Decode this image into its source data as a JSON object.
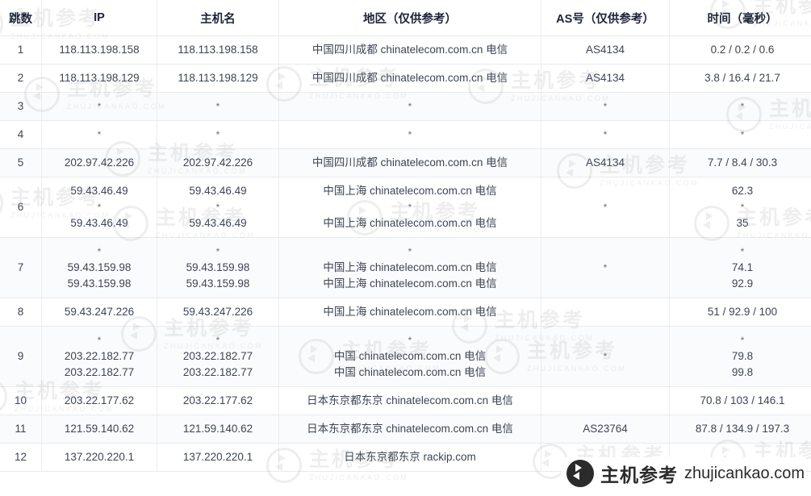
{
  "table": {
    "columns": [
      {
        "key": "hop",
        "label": "跳数"
      },
      {
        "key": "ip",
        "label": "IP"
      },
      {
        "key": "host",
        "label": "主机名"
      },
      {
        "key": "geo",
        "label": "地区（仅供参考）"
      },
      {
        "key": "as",
        "label": "AS号（仅供参考）"
      },
      {
        "key": "time",
        "label": "时间（毫秒）"
      }
    ],
    "rows": [
      {
        "hop": "1",
        "ip": [
          "118.113.198.158"
        ],
        "host": [
          "118.113.198.158"
        ],
        "geo": [
          "中国四川成都 chinatelecom.com.cn 电信"
        ],
        "as": [
          "AS4134"
        ],
        "time": [
          "0.2 / 0.2 / 0.6"
        ],
        "striped": false
      },
      {
        "hop": "2",
        "ip": [
          "118.113.198.129"
        ],
        "host": [
          "118.113.198.129"
        ],
        "geo": [
          "中国四川成都 chinatelecom.com.cn 电信"
        ],
        "as": [
          "AS4134"
        ],
        "time": [
          "3.8 / 16.4 / 21.7"
        ],
        "striped": false
      },
      {
        "hop": "3",
        "ip": [
          "*"
        ],
        "host": [
          "*"
        ],
        "geo": [
          "*"
        ],
        "as": [
          "*"
        ],
        "time": [
          "*"
        ],
        "striped": true
      },
      {
        "hop": "4",
        "ip": [
          "*"
        ],
        "host": [
          "*"
        ],
        "geo": [
          "*"
        ],
        "as": [
          "*"
        ],
        "time": [
          "*"
        ],
        "striped": false
      },
      {
        "hop": "5",
        "ip": [
          "202.97.42.226"
        ],
        "host": [
          "202.97.42.226"
        ],
        "geo": [
          "中国四川成都 chinatelecom.com.cn 电信"
        ],
        "as": [
          "AS4134"
        ],
        "time": [
          "7.7 / 8.4 / 30.3"
        ],
        "striped": true
      },
      {
        "hop": "6",
        "ip": [
          "59.43.46.49",
          "*",
          "59.43.46.49"
        ],
        "host": [
          "59.43.46.49",
          "*",
          "59.43.46.49"
        ],
        "geo": [
          "中国上海 chinatelecom.com.cn 电信",
          "*",
          "中国上海 chinatelecom.com.cn 电信"
        ],
        "as": [
          "*"
        ],
        "time": [
          "62.3",
          "*",
          "35"
        ],
        "striped": false
      },
      {
        "hop": "7",
        "ip": [
          "*",
          "59.43.159.98",
          "59.43.159.98"
        ],
        "host": [
          "*",
          "59.43.159.98",
          "59.43.159.98"
        ],
        "geo": [
          "*",
          "中国上海 chinatelecom.com.cn 电信",
          "中国上海 chinatelecom.com.cn 电信"
        ],
        "as": [
          "*"
        ],
        "time": [
          "*",
          "74.1",
          "92.9"
        ],
        "striped": true
      },
      {
        "hop": "8",
        "ip": [
          "59.43.247.226"
        ],
        "host": [
          "59.43.247.226"
        ],
        "geo": [
          "中国上海 chinatelecom.com.cn 电信"
        ],
        "as": [
          ""
        ],
        "time": [
          "51 / 92.9 / 100"
        ],
        "striped": false
      },
      {
        "hop": "9",
        "ip": [
          "*",
          "203.22.182.77",
          "203.22.182.77"
        ],
        "host": [
          "*",
          "203.22.182.77",
          "203.22.182.77"
        ],
        "geo": [
          "*",
          "中国 chinatelecom.com.cn 电信",
          "中国 chinatelecom.com.cn 电信"
        ],
        "as": [
          "*"
        ],
        "time": [
          "*",
          "79.8",
          "99.8"
        ],
        "striped": true
      },
      {
        "hop": "10",
        "ip": [
          "203.22.177.62"
        ],
        "host": [
          "203.22.177.62"
        ],
        "geo": [
          "日本东京都东京 chinatelecom.com.cn 电信"
        ],
        "as": [
          ""
        ],
        "time": [
          "70.8 / 103 / 146.1"
        ],
        "striped": false
      },
      {
        "hop": "11",
        "ip": [
          "121.59.140.62"
        ],
        "host": [
          "121.59.140.62"
        ],
        "geo": [
          "日本东京都东京 chinatelecom.com.cn 电信"
        ],
        "as": [
          "AS23764"
        ],
        "time": [
          "87.8 / 134.9 / 197.3"
        ],
        "striped": true
      },
      {
        "hop": "12",
        "ip": [
          "137.220.220.1"
        ],
        "host": [
          "137.220.220.1"
        ],
        "geo": [
          "日本东京都东京 rackip.com"
        ],
        "as": [
          ""
        ],
        "time": [
          ""
        ],
        "striped": false
      }
    ]
  },
  "watermark": {
    "cn": "主机参考",
    "en": "ZHUJICANKAO.COM",
    "corner_cn": "主机参考",
    "corner_en": "zhujicankao.com"
  },
  "colors": {
    "link": "#5b8cb3",
    "text": "#3d4454",
    "header_text": "#1c2438",
    "border": "#e8eaec",
    "stripe": "#fafbfc"
  }
}
